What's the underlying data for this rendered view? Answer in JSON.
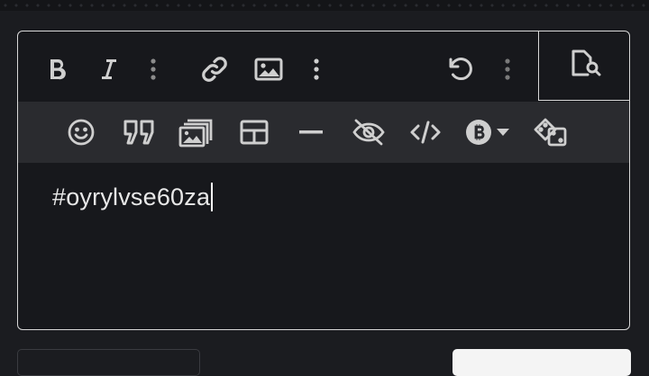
{
  "editor": {
    "content": "#oyrylvse60za"
  },
  "toolbar_primary": {
    "buttons": [
      "bold-icon",
      "italic-icon",
      "more-vertical-icon",
      "link-icon",
      "image-icon",
      "more-vertical-icon",
      "undo-icon",
      "more-vertical-icon",
      "preview-icon"
    ]
  },
  "toolbar_secondary": {
    "buttons": [
      "emoji-icon",
      "quote-icon",
      "gallery-icon",
      "table-icon",
      "horizontal-rule-icon",
      "spoiler-icon",
      "code-icon",
      "bitcoin-icon",
      "dice-icon"
    ]
  },
  "colors": {
    "background": "#1b1c20",
    "editor_bg": "#17181c",
    "toolbar2_bg": "#2a2b2f",
    "icon": "#cfcfcf",
    "text": "#e8e8e8"
  }
}
